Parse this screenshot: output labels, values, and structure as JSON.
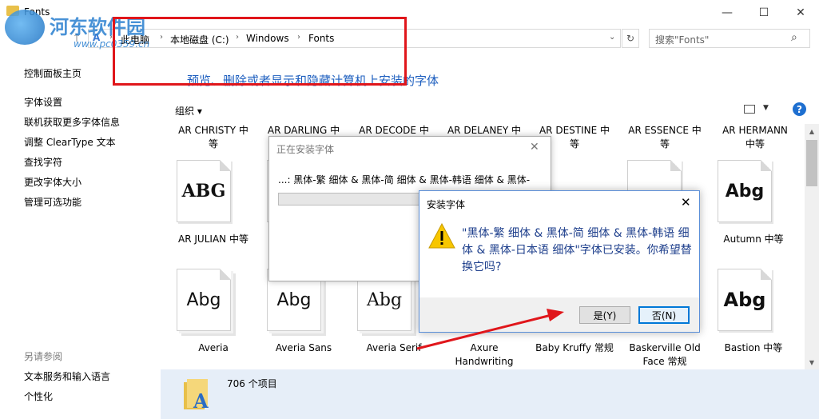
{
  "window": {
    "title": "Fonts",
    "controls": {
      "minimize": "—",
      "maximize": "☐",
      "close": "✕"
    }
  },
  "watermark": {
    "title": "河东软件园",
    "url": "www.pc0359.cn"
  },
  "address": {
    "breadcrumbs": [
      "此电脑",
      "本地磁盘 (C:)",
      "Windows",
      "Fonts"
    ],
    "search_placeholder": "搜索\"Fonts\""
  },
  "left_pane": {
    "home": "控制面板主页",
    "links": [
      "字体设置",
      "联机获取更多字体信息",
      "调整 ClearType 文本",
      "查找字符",
      "更改字体大小",
      "管理可选功能"
    ],
    "see_also_title": "另请参阅",
    "see_also": [
      "文本服务和输入语言",
      "个性化"
    ]
  },
  "main": {
    "heading": "预览、删除或者显示和隐藏计算机上安装的字体",
    "organize": "组织 ▾",
    "top_row_names": [
      [
        "AR CHRISTY 中",
        "等"
      ],
      [
        "AR DARLING 中",
        ""
      ],
      [
        "AR DECODE 中",
        ""
      ],
      [
        "AR DELANEY 中",
        ""
      ],
      [
        "AR DESTINE 中",
        "等"
      ],
      [
        "AR ESSENCE 中",
        "等"
      ],
      [
        "AR HERMANN",
        "中等"
      ]
    ],
    "row2": [
      {
        "name": "AR JULIAN 中等",
        "sample": "ABG"
      },
      {
        "name": "Autumn 中等",
        "sample": "Abg"
      }
    ],
    "row3": [
      {
        "name": "Averia",
        "sample": "Abg"
      },
      {
        "name": "Averia Sans",
        "sample": "Abg"
      },
      {
        "name": "Averia Serif",
        "sample": "Abg"
      },
      {
        "name": "Axure Handwriting",
        "sample": ""
      },
      {
        "name": "Baby Kruffy 常规",
        "sample": ""
      },
      {
        "name": "Baskerville Old Face 常规",
        "sample": ""
      },
      {
        "name": "Bastion 中等",
        "sample": "Abg"
      }
    ]
  },
  "status": {
    "count": "706 个项目"
  },
  "progress_dialog": {
    "title": "正在安装字体",
    "message": "...: 黑体-繁 细体 & 黑体-简 细体 & 黑体-韩语 细体 & 黑体-",
    "progress": 0
  },
  "confirm_dialog": {
    "title": "安装字体",
    "message": "\"黑体-繁 细体 & 黑体-简 细体 & 黑体-韩语 细体 & 黑体-日本语 细体\"字体已安装。你希望替换它吗?",
    "yes": "是(Y)",
    "no": "否(N)"
  },
  "colors": {
    "annotation_red": "#e0161b",
    "link_blue": "#1e5fbf",
    "dialog_text": "#1e3f8c"
  }
}
